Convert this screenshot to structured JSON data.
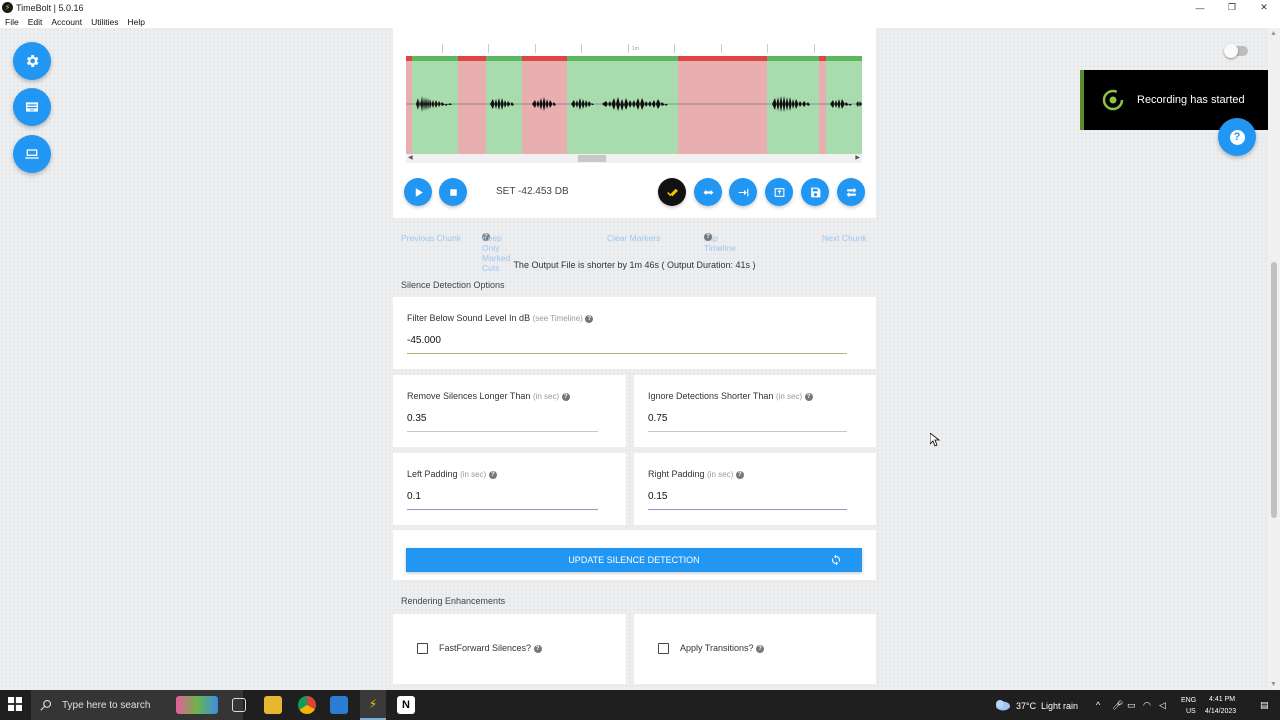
{
  "window": {
    "title": "TimeBolt | 5.0.16",
    "app_icon": "bolt-icon",
    "controls": [
      "minimize-icon",
      "restore-icon",
      "close-icon"
    ]
  },
  "menu": [
    "File",
    "Edit",
    "Account",
    "Utilities",
    "Help"
  ],
  "toast": {
    "message": "Recording has started",
    "icon": "recording-icon"
  },
  "timeline": {
    "tick_label": "1m",
    "set_db": "SET -42.453 DB"
  },
  "chunk_nav": {
    "previous": "Previous Chunk",
    "keep_only": "Keep Only Marked Cuts",
    "clear": "Clear Markers",
    "flip": "Flip Timeline",
    "next": "Next Chunk"
  },
  "output_info": "The Output File is shorter by 1m 46s ( Output Duration: 41s )",
  "silence": {
    "title": "Silence Detection Options",
    "filter": {
      "label": "Filter Below Sound Level In dB",
      "hint": "(see Timeline)",
      "value": "-45.000"
    },
    "remove": {
      "label": "Remove Silences Longer Than",
      "hint": "(in sec)",
      "value": "0.35"
    },
    "ignore": {
      "label": "Ignore Detections Shorter Than",
      "hint": "(in sec)",
      "value": "0.75"
    },
    "left_pad": {
      "label": "Left Padding",
      "hint": "(in sec)",
      "value": "0.1"
    },
    "right_pad": {
      "label": "Right Padding",
      "hint": "(in sec)",
      "value": "0.15"
    },
    "update_button": "UPDATE SILENCE DETECTION"
  },
  "rendering": {
    "title": "Rendering Enhancements",
    "fastforward": "FastForward Silences?",
    "transitions": "Apply Transitions?"
  },
  "taskbar": {
    "search_placeholder": "Type here to search",
    "weather_temp": "37°C",
    "weather_text": "Light rain",
    "lang": "ENG",
    "region": "US",
    "time": "4:41 PM",
    "date": "4/14/2023"
  },
  "colors": {
    "accent": "#2196f3",
    "keep_green": "#a8dcae",
    "cut_red": "#e8aeb0",
    "bar_green": "#5cb85c",
    "bar_red": "#e04545"
  }
}
